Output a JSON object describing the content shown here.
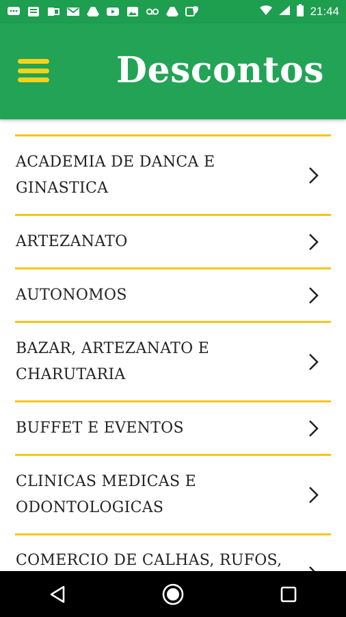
{
  "status_bar": {
    "time": "21:44",
    "icons": [
      "chat-icon",
      "news-icon",
      "office-icon",
      "gmail-icon",
      "drive-icon",
      "youtube-icon",
      "photos-icon",
      "voicemail-icon",
      "drive-icon",
      "location-icon",
      "wifi-icon",
      "signal-icon",
      "battery-icon"
    ]
  },
  "app_bar": {
    "title": "Descontos",
    "menu_icon": "hamburger-menu-icon"
  },
  "colors": {
    "status_bar": "#1e9e4f",
    "app_bar": "#22a356",
    "accent": "#f5c518",
    "menu_icon": "#f5d21a"
  },
  "categories": [
    {
      "label": "ACADEMIA DE DANCA E GINASTICA"
    },
    {
      "label": "ARTEZANATO"
    },
    {
      "label": "AUTONOMOS"
    },
    {
      "label": "BAZAR, ARTEZANATO E CHARUTARIA"
    },
    {
      "label": "BUFFET E EVENTOS"
    },
    {
      "label": "CLINICAS MEDICAS E ODONTOLOGICAS"
    },
    {
      "label": "COMERCIO DE CALHAS, RUFOS,"
    }
  ],
  "nav_bar": {
    "back_icon": "back-triangle-icon",
    "home_icon": "home-circle-icon",
    "recents_icon": "recents-square-icon"
  }
}
